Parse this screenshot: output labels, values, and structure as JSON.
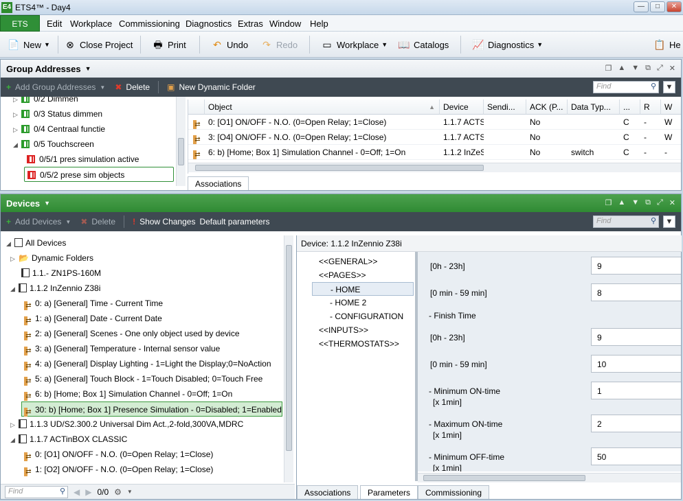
{
  "window": {
    "title": "ETS4™ - Day4",
    "app_icon": "E4",
    "controls": [
      "—",
      "□",
      "✕"
    ]
  },
  "menu": {
    "ets": "ETS",
    "items": [
      "Edit",
      "Workplace",
      "Commissioning",
      "Diagnostics",
      "Extras",
      "Window",
      "Help"
    ]
  },
  "toolbar": {
    "new": "New",
    "close_project": "Close Project",
    "print": "Print",
    "undo": "Undo",
    "redo": "Redo",
    "workplace": "Workplace",
    "catalogs": "Catalogs",
    "diagnostics": "Diagnostics",
    "help": "He"
  },
  "group_addresses": {
    "title": "Group Addresses",
    "add_label": "Add Group Addresses",
    "delete_label": "Delete",
    "new_folder_label": "New Dynamic Folder",
    "find_placeholder": "Find",
    "tree": [
      {
        "label": "0/2 Dimmen"
      },
      {
        "label": "0/3 Status dimmen"
      },
      {
        "label": "0/4 Centraal functie"
      },
      {
        "label": "0/5 Touchscreen"
      },
      {
        "label": "0/5/1 pres simulation active"
      },
      {
        "label": "0/5/2 prese sim objects"
      }
    ],
    "columns": [
      "Object",
      "Device",
      "Sendi...",
      "ACK (P...",
      "Data Typ...",
      "...",
      "R",
      "W"
    ],
    "rows": [
      {
        "object": "0: [O1] ON/OFF - N.O. (0=Open Relay; 1=Close)",
        "device": "1.1.7  ACTS",
        "ack": "No",
        "dtype": "",
        "c": "C",
        "r": "-",
        "w": "W"
      },
      {
        "object": "3: [O4] ON/OFF - N.O. (0=Open Relay; 1=Close)",
        "device": "1.1.7  ACTS",
        "ack": "No",
        "dtype": "",
        "c": "C",
        "r": "-",
        "w": "W"
      },
      {
        "object": "6: b)  [Home; Box 1] Simulation Channel - 0=Off; 1=On",
        "device": "1.1.2  InZeS",
        "ack": "No",
        "dtype": "switch",
        "c": "C",
        "r": "-",
        "w": "-"
      }
    ],
    "tab_associations": "Associations"
  },
  "devices": {
    "title": "Devices",
    "add_label": "Add Devices",
    "delete_label": "Delete",
    "show_changes": "Show Changes",
    "default_params": "Default parameters",
    "find_placeholder": "Find",
    "tree": [
      {
        "label": "All Devices"
      },
      {
        "label": "Dynamic Folders"
      },
      {
        "label": "1.1.-   ZN1PS-160M"
      },
      {
        "label": "1.1.2  InZennio Z38i"
      },
      {
        "label": "0: a)  [General] Time - Current Time"
      },
      {
        "label": "1: a)  [General] Date - Current Date"
      },
      {
        "label": "2: a)  [General] Scenes - One only object used by device"
      },
      {
        "label": "3: a)  [General] Temperature - Internal sensor value"
      },
      {
        "label": "4: a)  [General] Display Lighting - 1=Light the Display;0=NoAction"
      },
      {
        "label": "5: a)  [General] Touch Block - 1=Touch Disabled; 0=Touch Free"
      },
      {
        "label": "6: b)  [Home; Box 1] Simulation Channel - 0=Off; 1=On"
      },
      {
        "label": "30: b)  [Home; Box 1] Presence Simulation - 0=Disabled; 1=Enabled"
      },
      {
        "label": "1.1.3  UD/S2.300.2 Universal Dim Act.,2-fold,300VA,MDRC"
      },
      {
        "label": "1.1.7  ACTinBOX CLASSIC"
      },
      {
        "label": "0: [O1] ON/OFF - N.O. (0=Open Relay; 1=Close)"
      },
      {
        "label": "1: [O2] ON/OFF - N.O. (0=Open Relay; 1=Close)"
      }
    ],
    "footer_find": "Find",
    "footer_count": "0/0",
    "device_header": "Device: 1.1.2  InZennio Z38i",
    "nav": [
      "<<GENERAL>>",
      "<<PAGES>>",
      "- HOME",
      "- HOME 2",
      "- CONFIGURATION",
      "<<INPUTS>>",
      "<<THERMOSTATS>>"
    ],
    "params": [
      {
        "label": "[0h - 23h]",
        "value": "9"
      },
      {
        "label": "[0 min - 59 min]",
        "value": "8"
      },
      {
        "label": "- Finish Time",
        "value": ""
      },
      {
        "label": "[0h - 23h]",
        "value": "9"
      },
      {
        "label": "[0 min - 59 min]",
        "value": "10"
      },
      {
        "label": "- Minimum ON-time",
        "sub": "[x 1min]",
        "value": "1"
      },
      {
        "label": "- Maximum ON-time",
        "sub": "[x 1min]",
        "value": "2"
      },
      {
        "label": "- Minimum OFF-time",
        "sub": "[x 1min]",
        "value": "50"
      }
    ],
    "tabs": [
      "Associations",
      "Parameters",
      "Commissioning"
    ]
  }
}
